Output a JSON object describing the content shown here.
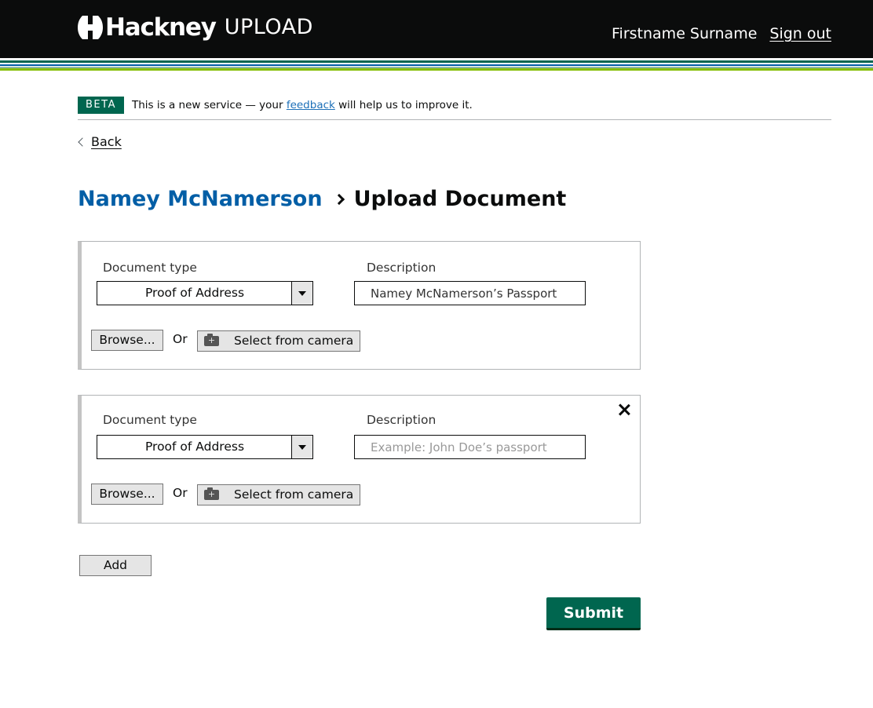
{
  "header": {
    "logo_text": "Hackney",
    "service_name": "UPLOAD",
    "user_name": "Firstname Surname",
    "sign_out_label": "Sign out",
    "stripe_colors": [
      "#0b0c0c",
      "#ffffff",
      "#00664f",
      "#ffffff",
      "#025ea6",
      "#ffffff",
      "#8eb8a6",
      "#84bd00"
    ]
  },
  "beta_banner": {
    "tag": "BETA",
    "text_before": "This is a new service — your ",
    "link_text": "feedback",
    "text_after": " will help us to improve it."
  },
  "back_link": {
    "label": "Back"
  },
  "heading": {
    "resident_name": "Namey McNamerson",
    "page_title": "Upload Document"
  },
  "documents": [
    {
      "document_type_label": "Document type",
      "document_type_value": "Proof of Address",
      "description_label": "Description",
      "description_value": "Namey McNamerson’s Passport",
      "description_placeholder": "Example: John Doe’s passport",
      "browse_label": "Browse...",
      "or_label": "Or",
      "camera_label": "Select from camera",
      "removable": false
    },
    {
      "document_type_label": "Document type",
      "document_type_value": "Proof of Address",
      "description_label": "Description",
      "description_value": "",
      "description_placeholder": "Example: John Doe’s passport",
      "browse_label": "Browse...",
      "or_label": "Or",
      "camera_label": "Select from camera",
      "removable": true
    }
  ],
  "actions": {
    "add_label": "Add",
    "submit_label": "Submit"
  },
  "colors": {
    "header_bg": "#0b0c0c",
    "link_blue": "#025ea6",
    "feedback_link": "#1d70b8",
    "primary_green": "#00664f",
    "beta_green": "#00664f"
  }
}
